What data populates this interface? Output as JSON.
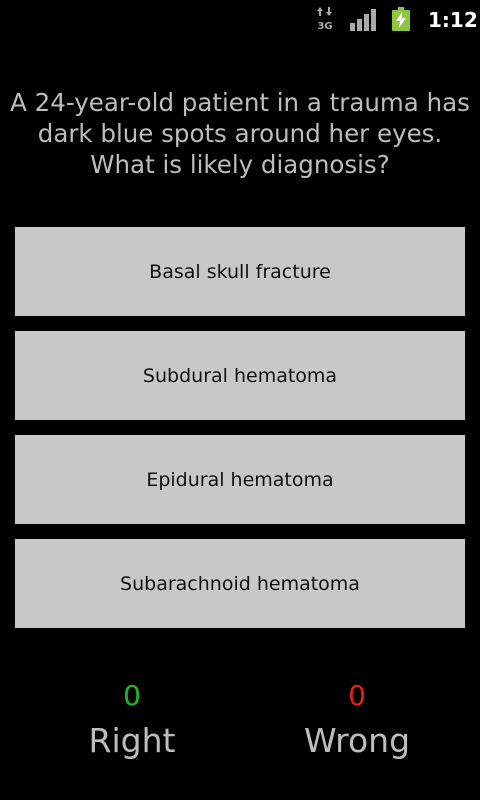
{
  "status_bar": {
    "network_type": "3G",
    "time": "1:12",
    "icons": [
      "data-transfer-icon",
      "signal-strength-icon",
      "battery-charging-icon"
    ]
  },
  "question": {
    "text": "A 24-year-old patient in a trauma has dark blue spots around her eyes. What is likely diagnosis?"
  },
  "answers": [
    {
      "label": "Basal skull fracture"
    },
    {
      "label": "Subdural hematoma"
    },
    {
      "label": "Epidural hematoma"
    },
    {
      "label": "Subarachnoid hematoma"
    }
  ],
  "score": {
    "right_count": "0",
    "right_label": "Right",
    "wrong_count": "0",
    "wrong_label": "Wrong"
  },
  "colors": {
    "right": "#1fb81f",
    "wrong": "#e01f1f",
    "button_bg": "#c8c9c6",
    "battery": "#8cc63f"
  }
}
